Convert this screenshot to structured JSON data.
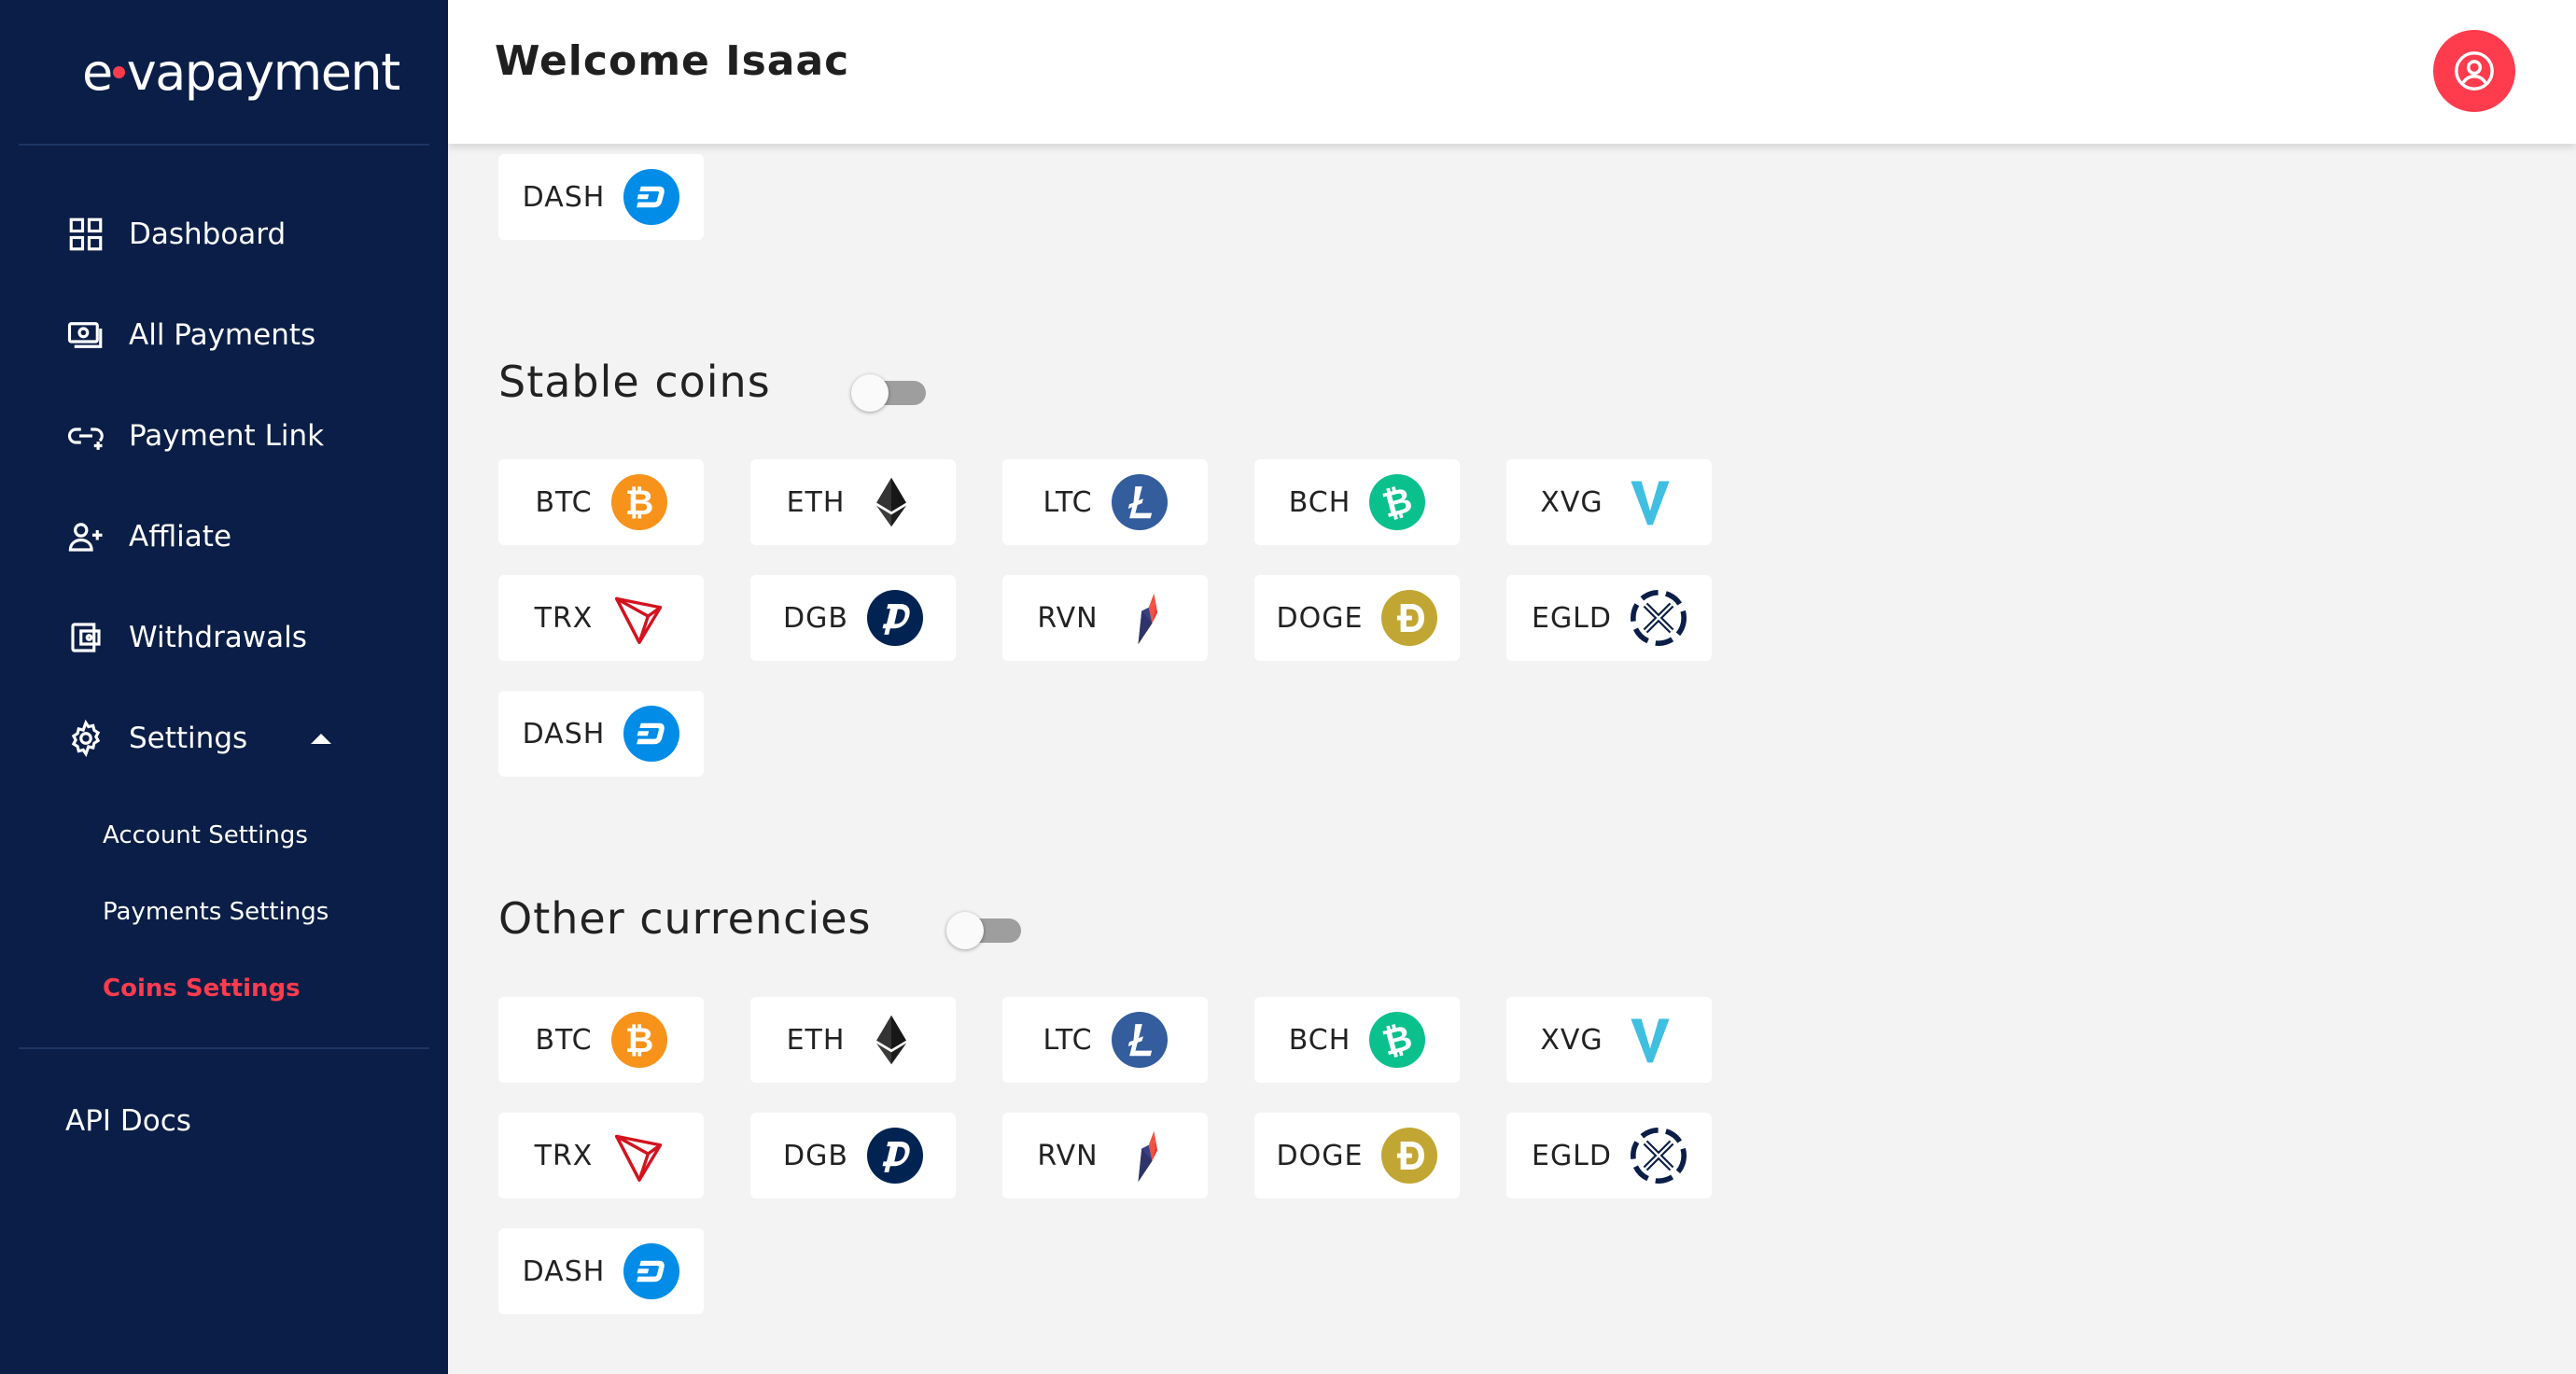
{
  "brand": {
    "logo_pre": "e",
    "logo_post": "vapayment"
  },
  "header": {
    "title": "Welcome Isaac"
  },
  "sidebar": {
    "items": [
      {
        "label": "Dashboard",
        "icon": "grid-icon"
      },
      {
        "label": "All Payments",
        "icon": "money-icon"
      },
      {
        "label": "Payment Link",
        "icon": "link-icon"
      },
      {
        "label": "Affliate",
        "icon": "user-plus-icon"
      },
      {
        "label": "Withdrawals",
        "icon": "wallet-icon"
      },
      {
        "label": "Settings",
        "icon": "gear-icon"
      }
    ],
    "sub_items": [
      {
        "label": "Account Settings"
      },
      {
        "label": "Payments Settings"
      },
      {
        "label": "Coins Settings",
        "active": true
      }
    ],
    "api_docs": "API Docs"
  },
  "top_partial": {
    "symbol": "DASH"
  },
  "sections": [
    {
      "title": "Stable coins",
      "enabled": false,
      "coins": [
        "BTC",
        "ETH",
        "LTC",
        "BCH",
        "XVG",
        "TRX",
        "DGB",
        "RVN",
        "DOGE",
        "EGLD",
        "DASH"
      ]
    },
    {
      "title": "Other currencies",
      "enabled": false,
      "coins": [
        "BTC",
        "ETH",
        "LTC",
        "BCH",
        "XVG",
        "TRX",
        "DGB",
        "RVN",
        "DOGE",
        "EGLD",
        "DASH"
      ]
    }
  ],
  "colors": {
    "sidebar_bg": "#0b1e47",
    "accent": "#ff3b4e",
    "btc": "#f7931a",
    "ltc": "#345d9d",
    "bch": "#0ac18e",
    "xvg": "#40bfe1",
    "trx": "#d3131f",
    "dgb": "#002352",
    "doge": "#c2a633",
    "dash": "#008ce7"
  }
}
